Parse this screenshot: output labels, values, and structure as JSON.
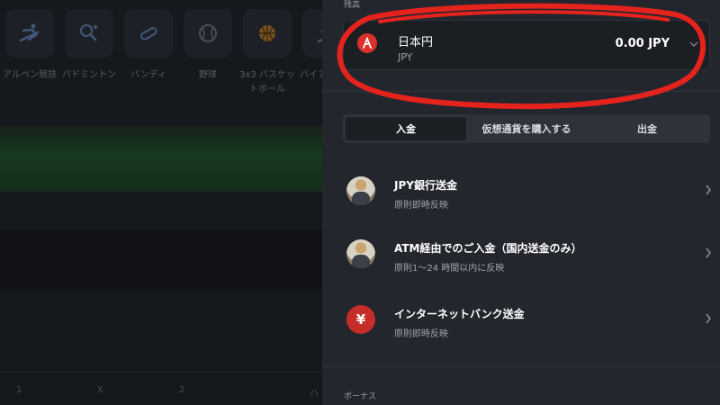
{
  "background": {
    "sports": [
      {
        "label": "アルペン競技",
        "icon": "skier-icon"
      },
      {
        "label": "バドミントン",
        "icon": "shuttlecock-icon"
      },
      {
        "label": "バンディ",
        "icon": "bandy-icon"
      },
      {
        "label": "野球",
        "icon": "baseball-icon"
      },
      {
        "label": "3x3 バスケットボール",
        "icon": "basketball-icon"
      },
      {
        "label": "バイアスロン",
        "icon": "biathlon-icon"
      }
    ],
    "odds_headers": [
      "1",
      "X",
      "2",
      "ハ"
    ]
  },
  "balance": {
    "section_label": "残高",
    "currency_name": "日本円",
    "currency_code": "JPY",
    "amount": "0.00 JPY",
    "flag_icon": "flag-jp-icon"
  },
  "tabs": [
    {
      "label": "入金",
      "active": true
    },
    {
      "label": "仮想通貨を購入する",
      "active": false
    },
    {
      "label": "出金",
      "active": false
    }
  ],
  "methods": [
    {
      "title": "JPY銀行送金",
      "subtitle": "原則即時反映",
      "icon": "bank-transfer-avatar"
    },
    {
      "title": "ATM経由でのご入金（国内送金のみ）",
      "subtitle": "原則1〜24 時間以内に反映",
      "icon": "atm-avatar"
    },
    {
      "title": "インターネットバンク送金",
      "subtitle": "原則即時反映",
      "icon": "yen-icon",
      "symbol": "¥"
    }
  ],
  "bonus": {
    "section_label": "ボーナス"
  },
  "colors": {
    "panel": "#23262d",
    "card": "#1b1e23",
    "accent_red": "#d9322a",
    "annotation": "#e5231d"
  }
}
